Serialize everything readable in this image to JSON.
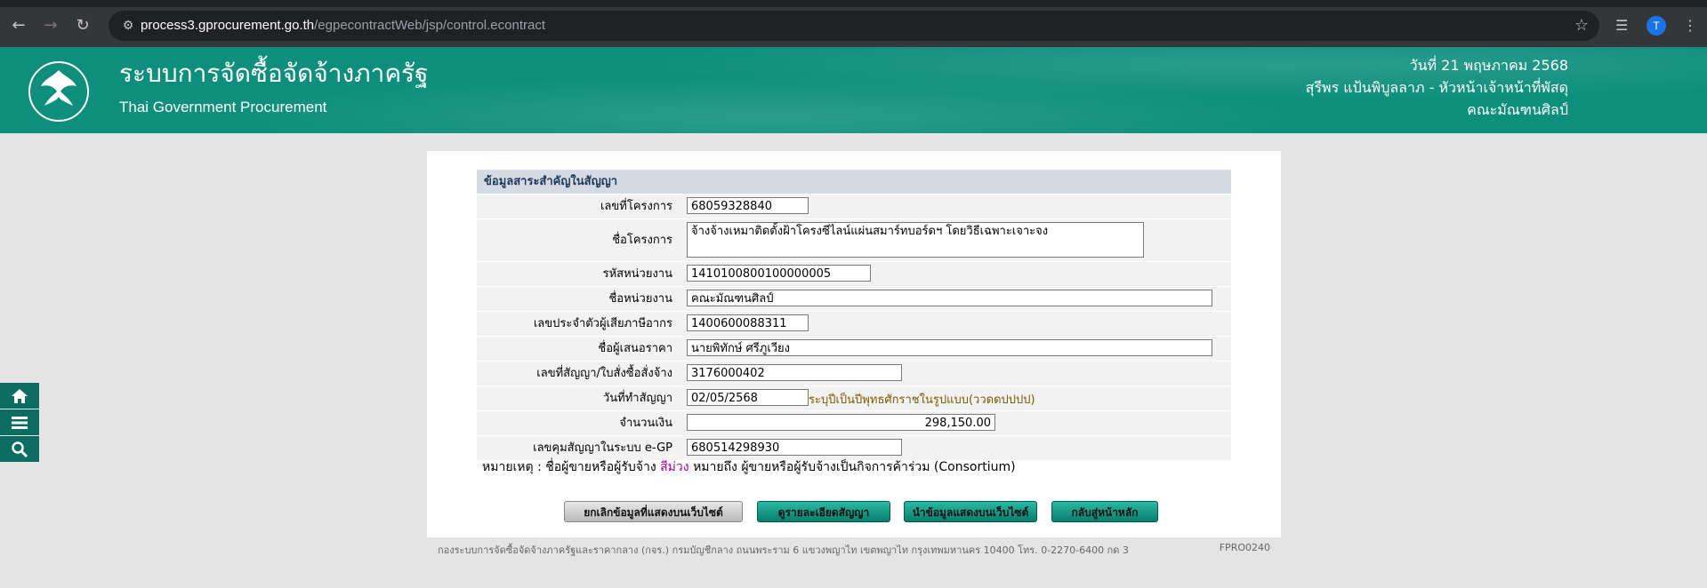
{
  "browser": {
    "url_host": "process3.gprocurement.go.th",
    "url_path": "/egpecontractWeb/jsp/control.econtract",
    "profile_initial": "T"
  },
  "header": {
    "title_th": "ระบบการจัดซื้อจัดจ้างภาครัฐ",
    "title_en": "Thai Government Procurement",
    "date": "วันที่ 21 พฤษภาคม 2568",
    "user": "สุรีพร แป้นพิบูลลาภ - หัวหน้าเจ้าหน้าที่พัสดุ",
    "unit": "คณะมัณฑนศิลป์"
  },
  "form": {
    "section_title": "ข้อมูลสาระสำคัญในสัญญา",
    "fields": [
      {
        "label": "เลขที่โครงการ",
        "value": "68059328840"
      },
      {
        "label": "ชื่อโครงการ",
        "value": "จ้างจ้างเหมาติดตั้งฝ้าโครงซีไลน์แผ่นสมาร์ทบอร์ดฯ โดยวิธีเฉพาะเจาะจง"
      },
      {
        "label": "รหัสหน่วยงาน",
        "value": "1410100800100000005"
      },
      {
        "label": "ชื่อหน่วยงาน",
        "value": "คณะมัณฑนศิลป์"
      },
      {
        "label": "เลขประจำตัวผู้เสียภาษีอากร",
        "value": "1400600088311"
      },
      {
        "label": "ชื่อผู้เสนอราคา",
        "value": "นายพิทักษ์ ศรีภูเวียง"
      },
      {
        "label": "เลขที่สัญญา/ใบสั่งซื้อสั่งจ้าง",
        "value": "3176000402"
      },
      {
        "label": "วันที่ทำสัญญา",
        "value": "02/05/2568",
        "hint": "ระบุปีเป็นปีพุทธศักราชในรูปแบบ(ววดดปปปป)"
      },
      {
        "label": "จำนวนเงิน",
        "value": "298,150.00"
      },
      {
        "label": "เลขคุมสัญญาในระบบ e-GP",
        "value": "680514298930"
      }
    ],
    "note_prefix": "หมายเหตุ : ชื่อผู้ขายหรือผู้รับจ้าง",
    "note_color_word": "สีม่วง",
    "note_suffix": "หมายถึง ผู้ขายหรือผู้รับจ้างเป็นกิจการค้าร่วม (Consortium)"
  },
  "buttons": {
    "cancel_display": "ยกเลิกข้อมูลที่แสดงบนเว็บไซต์",
    "view_detail": "ดูรายละเอียดสัญญา",
    "publish": "นำข้อมูลแสดงบนเว็บไซต์",
    "back": "กลับสู่หน้าหลัก"
  },
  "footer": {
    "text": "กองระบบการจัดซื้อจัดจ้างภาครัฐและราคากลาง (กจร.) กรมบัญชีกลาง ถนนพระราม 6 แขวงพญาไท เขตพญาไท กรุงเทพมหานคร 10400 โทร. 0-2270-6400 กด 3",
    "code": "FPRO0240"
  },
  "icons": {
    "home": "home-icon",
    "menu": "menu-icon",
    "search": "search-icon"
  },
  "colors": {
    "header_bg": "#0e8f7e",
    "side_nav_bg": "#0e6d63",
    "section_head_bg": "#d5dbe4",
    "consortium_purple": "#a000a0"
  }
}
